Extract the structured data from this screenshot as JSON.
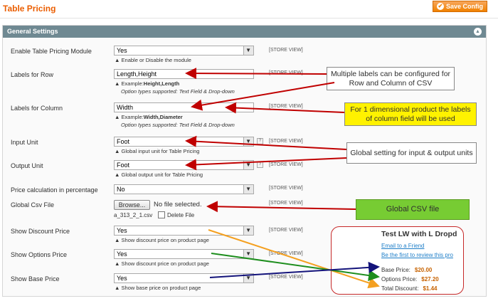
{
  "header": {
    "title": "Table Pricing",
    "save_label": "Save Config"
  },
  "section": {
    "title": "General Settings"
  },
  "scope_label": "[STORE VIEW]",
  "rows": [
    {
      "label": "Enable Table Pricing Module",
      "value": "Yes",
      "note": "Enable or Disable the module"
    },
    {
      "label": "Labels for Row",
      "value": "Length,Height",
      "note_prefix": "Example:",
      "note_bold": "Height,Length",
      "note2": "Option types supported: Text Field & Drop-down"
    },
    {
      "label": "Labels for Column",
      "value": "Width",
      "note_prefix": "Example:",
      "note_bold": "Width,Diameter",
      "note2": "Option types supported: Text Field & Drop-down"
    },
    {
      "label": "Input Unit",
      "value": "Foot",
      "note": "Global input unit for Table Pricing"
    },
    {
      "label": "Output Unit",
      "value": "Foot",
      "note": "Global output unit for Table Pricing"
    },
    {
      "label": "Price calculation in percentage",
      "value": "No"
    },
    {
      "label": "Global Csv File",
      "browse": "Browse...",
      "file_status": "No file selected.",
      "file_name": "a_313_2_1.csv",
      "delete_label": "Delete File"
    },
    {
      "label": "Show Discount Price",
      "value": "Yes",
      "note": "Show discount price on product page"
    },
    {
      "label": "Show Options Price",
      "value": "Yes",
      "note": "Show discount price on product page"
    },
    {
      "label": "Show Base Price",
      "value": "Yes",
      "note": "Show base price on product page"
    }
  ],
  "callouts": {
    "multiple": "Multiple labels can be configured for Row and Column of CSV",
    "one_dim": "For 1 dimensional product the labels of column field will be used",
    "units": "Global setting for input & output units",
    "csv": "Global CSV file"
  },
  "product": {
    "title": "Test LW with L Dropd",
    "email": "Email to a Friend",
    "review": "Be the first to review this pro",
    "base_label": "Base Price:",
    "base_value": "$20.00",
    "options_label": "Options Price:",
    "options_value": "$27.20",
    "discount_label": "Total Discount:",
    "discount_value": "$1.44"
  },
  "colors": {
    "accent": "#eb5e00",
    "arrow_red": "#c00000",
    "arrow_orange": "#f4a020",
    "arrow_green": "#1e8e1e",
    "arrow_blue": "#13137a",
    "callout_yellow": "#fff200",
    "callout_green": "#77cc33"
  }
}
